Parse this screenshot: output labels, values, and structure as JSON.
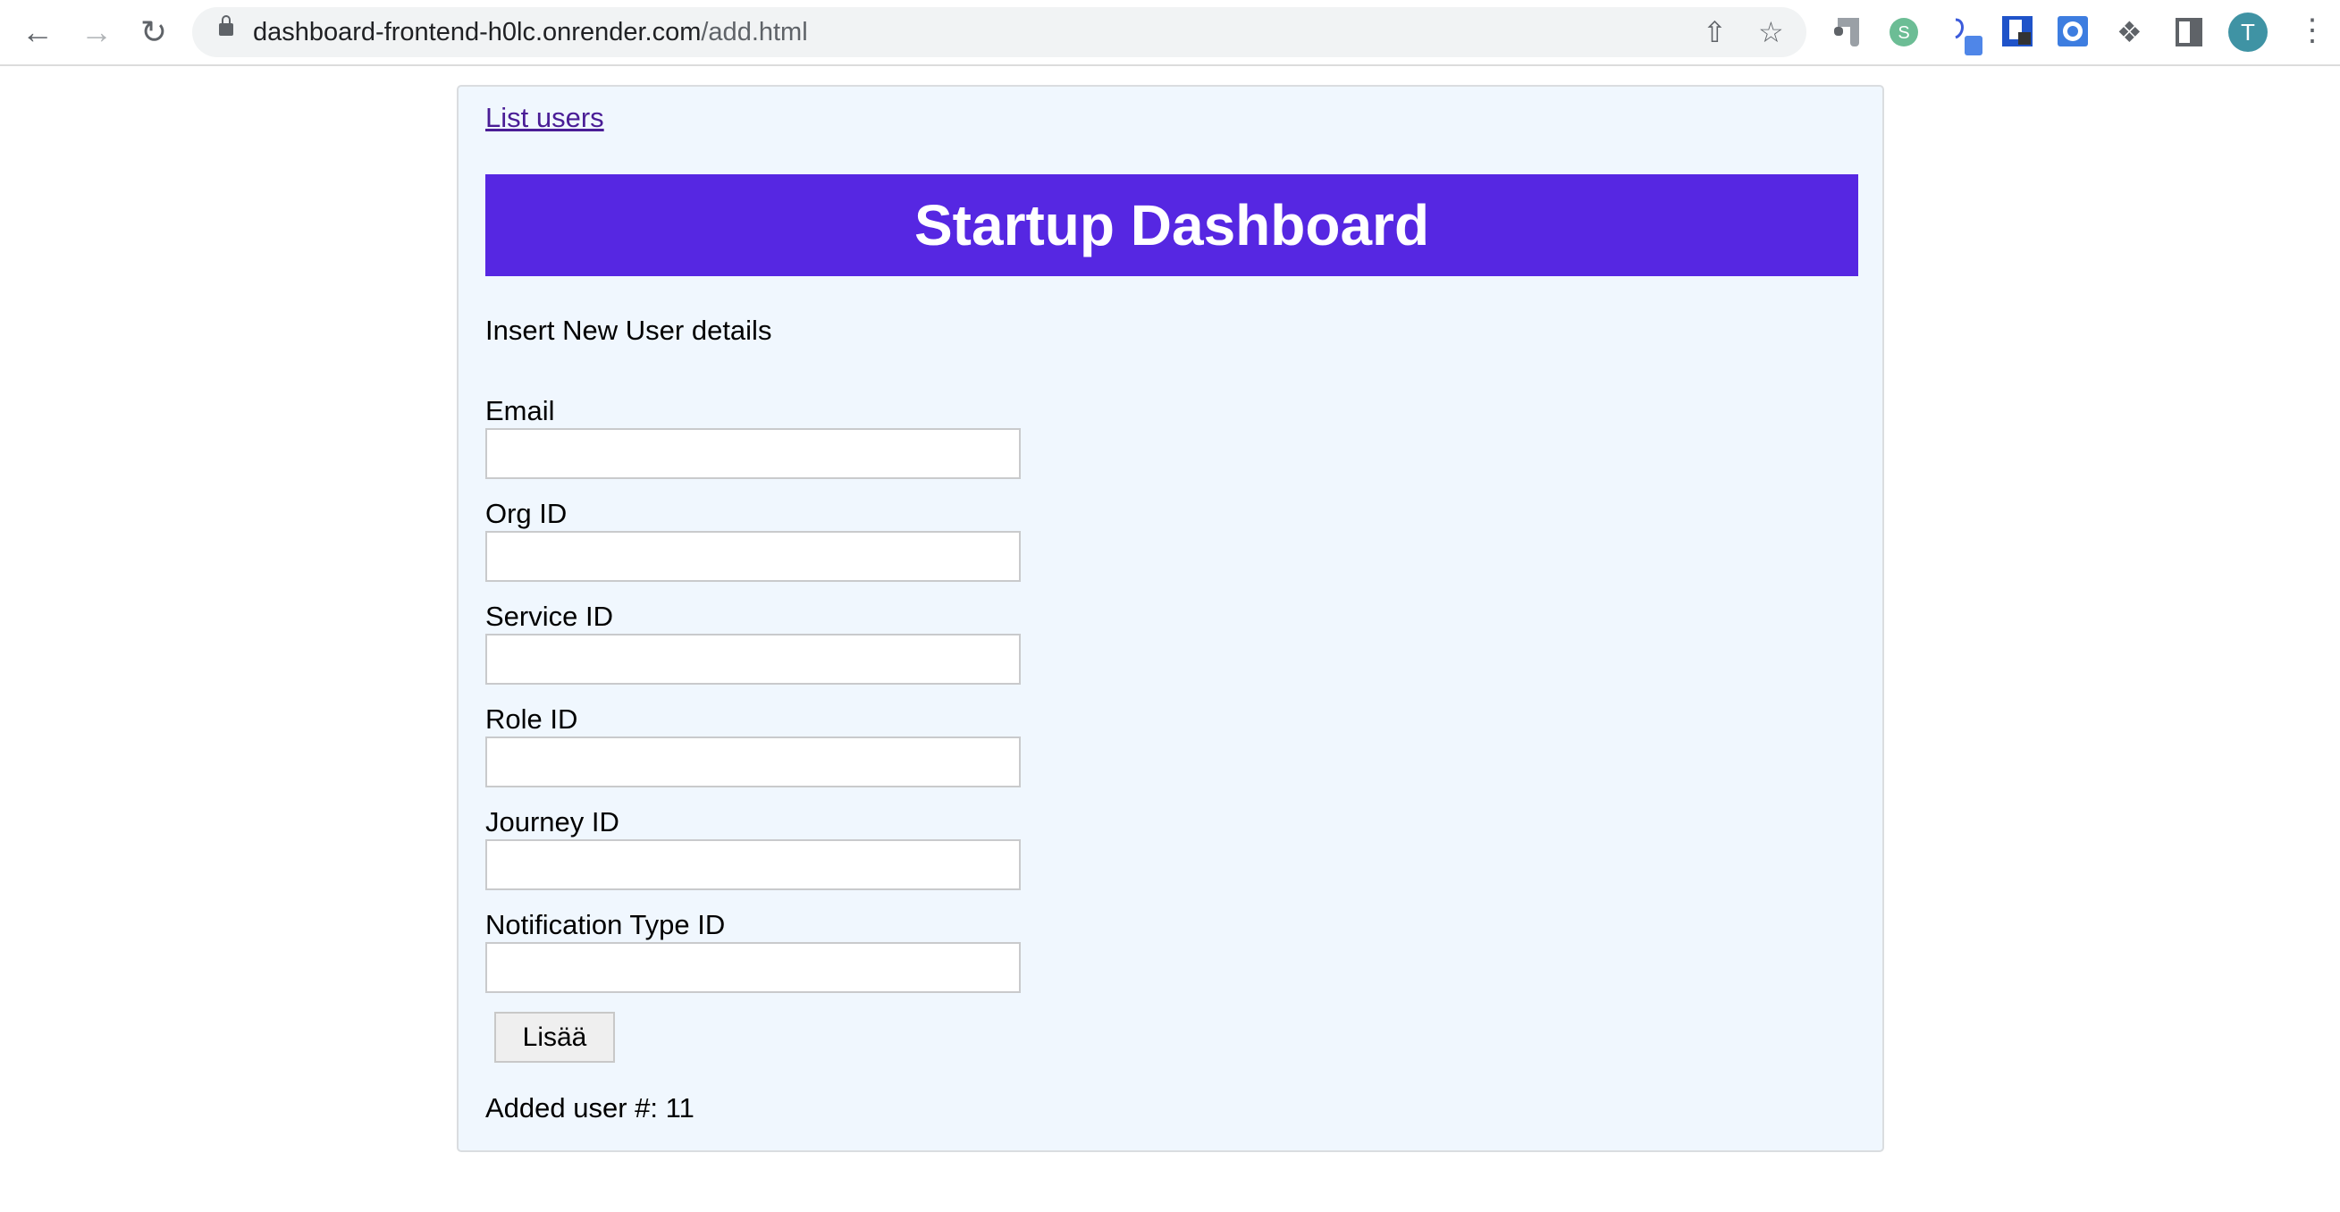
{
  "browser": {
    "url_domain": "dashboard-frontend-h0lc.onrender.com",
    "url_path": "/add.html",
    "avatar_letter": "T",
    "icons": [
      "back-icon",
      "forward-icon",
      "reload-icon",
      "lock-icon",
      "share-icon",
      "star-icon",
      "extension-icons",
      "puzzle-icon",
      "sidebar-icon",
      "menu-icon"
    ]
  },
  "page": {
    "nav_link": "List users",
    "header_title": "Startup Dashboard",
    "subtitle": "Insert New User details",
    "fields": [
      {
        "label": "Email",
        "value": ""
      },
      {
        "label": "Org ID",
        "value": ""
      },
      {
        "label": "Service ID",
        "value": ""
      },
      {
        "label": "Role ID",
        "value": ""
      },
      {
        "label": "Journey ID",
        "value": ""
      },
      {
        "label": "Notification Type ID",
        "value": ""
      }
    ],
    "submit_label": "Lisää",
    "status": "Added user #: 11"
  },
  "colors": {
    "header_bg": "#5627e2",
    "card_bg": "#f0f7fe",
    "link": "#4a1d96"
  }
}
